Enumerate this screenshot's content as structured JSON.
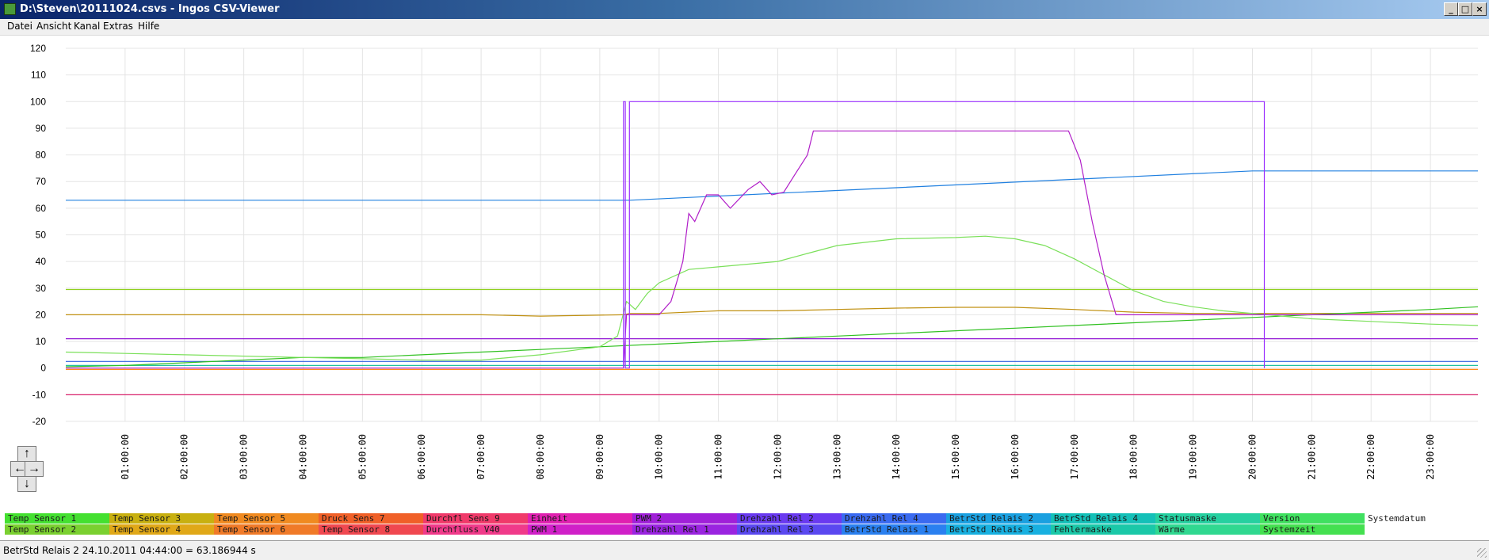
{
  "window": {
    "title": "D:\\Steven\\20111024.csvs - Ingos CSV-Viewer",
    "icon": "app-icon",
    "controls": [
      "_",
      "□",
      "×"
    ]
  },
  "menu": [
    "Datei",
    "Ansicht",
    "Kanal",
    "Extras",
    "Hilfe"
  ],
  "nav": {
    "up": "↑",
    "left": "←",
    "right": "→",
    "down": "↓"
  },
  "chart_data": {
    "type": "line",
    "ylim": [
      -20,
      120
    ],
    "yticks": [
      120,
      110,
      100,
      90,
      80,
      70,
      60,
      50,
      40,
      30,
      20,
      10,
      0,
      -10,
      -20
    ],
    "xlim": [
      0,
      23.8
    ],
    "xticks": [
      "01:00:00",
      "02:00:00",
      "03:00:00",
      "04:00:00",
      "05:00:00",
      "06:00:00",
      "07:00:00",
      "08:00:00",
      "09:00:00",
      "10:00:00",
      "11:00:00",
      "12:00:00",
      "13:00:00",
      "14:00:00",
      "15:00:00",
      "16:00:00",
      "17:00:00",
      "18:00:00",
      "19:00:00",
      "20:00:00",
      "21:00:00",
      "22:00:00",
      "23:00:00"
    ],
    "grid": true,
    "series": [
      {
        "color": "#d8206a",
        "x": [
          0,
          23.8
        ],
        "y": [
          -10,
          -10
        ]
      },
      {
        "color": "#ff8c1a",
        "x": [
          0,
          23.8
        ],
        "y": [
          -0.5,
          -0.5
        ]
      },
      {
        "color": "#22c0a0",
        "x": [
          0,
          23.8
        ],
        "y": [
          1,
          1
        ]
      },
      {
        "color": "#3060e0",
        "x": [
          0,
          23.8
        ],
        "y": [
          2.5,
          2.5
        ]
      },
      {
        "color": "#8800d0",
        "x": [
          0,
          23.8
        ],
        "y": [
          11,
          11
        ]
      },
      {
        "color": "#90d020",
        "x": [
          0,
          23.8
        ],
        "y": [
          29.5,
          29.5
        ]
      },
      {
        "color": "#2080e0",
        "x": [
          0,
          9.5,
          20,
          23.8
        ],
        "y": [
          63,
          63,
          74,
          74
        ]
      },
      {
        "color": "#c09010",
        "x": [
          0,
          7,
          8,
          9.4,
          9.5,
          10,
          11,
          12,
          13,
          14,
          15,
          16,
          17,
          18,
          19,
          20,
          23.8
        ],
        "y": [
          20,
          20,
          19.5,
          20,
          20.5,
          20.5,
          21.5,
          21.5,
          22,
          22.5,
          22.8,
          22.8,
          22,
          21,
          20.5,
          20.5,
          20.5
        ]
      },
      {
        "color": "#30c020",
        "x": [
          0,
          1,
          2,
          3,
          4,
          5,
          6,
          7,
          8,
          9,
          10,
          11,
          12,
          13,
          14,
          15,
          16,
          17,
          18,
          19,
          20,
          21,
          22,
          23,
          23.8
        ],
        "y": [
          0.5,
          1,
          2,
          3,
          4,
          4,
          5,
          6,
          7,
          8,
          9,
          10,
          11,
          12,
          13,
          14,
          15,
          16,
          17,
          18,
          19,
          20,
          21,
          22,
          23
        ]
      },
      {
        "color": "#7be05a",
        "x": [
          0,
          1,
          2,
          3,
          4,
          5,
          6,
          7,
          8,
          9,
          9.3,
          9.45,
          9.6,
          9.8,
          10,
          10.5,
          11,
          11.5,
          12,
          12.5,
          13,
          14,
          15,
          15.5,
          16,
          16.5,
          17,
          17.5,
          18,
          18.5,
          19,
          19.5,
          20,
          20.5,
          21,
          22,
          23,
          23.8
        ],
        "y": [
          6,
          5.5,
          5,
          4.5,
          4,
          3.5,
          3,
          3,
          5,
          8,
          12,
          25,
          22,
          28,
          32,
          37,
          38,
          39,
          40,
          43,
          46,
          48.5,
          49,
          49.5,
          48.5,
          46,
          41,
          35,
          29,
          25,
          23,
          21.5,
          20.5,
          19.5,
          18.5,
          17.5,
          16.5,
          16
        ]
      },
      {
        "color": "#b01ec8",
        "x": [
          0,
          9.4,
          9.45,
          10,
          10.2,
          10.4,
          10.5,
          10.6,
          10.8,
          11,
          11.2,
          11.5,
          11.7,
          11.9,
          12.1,
          12.3,
          12.5,
          12.6,
          16.9,
          17.1,
          17.3,
          17.5,
          17.7,
          20,
          20.2,
          23.8
        ],
        "y": [
          0,
          0,
          20,
          20,
          25,
          40,
          58,
          55,
          65,
          65,
          60,
          67,
          70,
          65,
          66,
          73,
          80,
          89,
          89,
          78,
          55,
          35,
          20,
          20,
          20,
          20
        ]
      },
      {
        "color": "#9b30ff",
        "x": [
          9.4,
          9.4,
          9.43,
          9.43,
          9.5,
          9.5,
          20.2,
          20.2
        ],
        "y": [
          0,
          100,
          100,
          0,
          0,
          100,
          100,
          0
        ]
      }
    ]
  },
  "legend": [
    {
      "label": "Temp Sensor 1",
      "color": "#44e030"
    },
    {
      "label": "Temp Sensor 2",
      "color": "#7ad030"
    },
    {
      "label": "Temp Sensor 3",
      "color": "#c8b010"
    },
    {
      "label": "Temp Sensor 4",
      "color": "#e0a818"
    },
    {
      "label": "Temp Sensor 5",
      "color": "#f08a20"
    },
    {
      "label": "Temp Sensor 6",
      "color": "#f07a28"
    },
    {
      "label": "Druck Sens 7",
      "color": "#f06028"
    },
    {
      "label": "Temp Sensor 8",
      "color": "#f04850"
    },
    {
      "label": "Durchfl Sens 9",
      "color": "#f03a6a"
    },
    {
      "label": "Durchfluss V40",
      "color": "#f03a8a"
    },
    {
      "label": "Einheit",
      "color": "#e020b0"
    },
    {
      "label": "PWM 1",
      "color": "#d020c8"
    },
    {
      "label": "PWM 2",
      "color": "#a020d8"
    },
    {
      "label": "Drehzahl Rel 1",
      "color": "#9a24e0"
    },
    {
      "label": "Drehzahl Rel 2",
      "color": "#6a3af0"
    },
    {
      "label": "Drehzahl Rel 3",
      "color": "#5a48f0"
    },
    {
      "label": "Drehzahl Rel 4",
      "color": "#3a6af0"
    },
    {
      "label": "BetrStd Relais 1",
      "color": "#2a80f0"
    },
    {
      "label": "BetrStd Relais 2",
      "color": "#1aa0e0"
    },
    {
      "label": "BetrStd Relais 3",
      "color": "#18b0e0"
    },
    {
      "label": "BetrStd Relais 4",
      "color": "#14c0b8"
    },
    {
      "label": "Fehlermaske",
      "color": "#1ac8a8"
    },
    {
      "label": "Statusmaske",
      "color": "#26d0a0"
    },
    {
      "label": "Wärme",
      "color": "#30d890"
    },
    {
      "label": "Version",
      "color": "#40e060"
    },
    {
      "label": "Systemzeit",
      "color": "#44e050"
    },
    {
      "label": "Systemdatum",
      "color": "#ffffff"
    }
  ],
  "status": "BetrStd Relais 2 24.10.2011 04:44:00 = 63.186944 s"
}
